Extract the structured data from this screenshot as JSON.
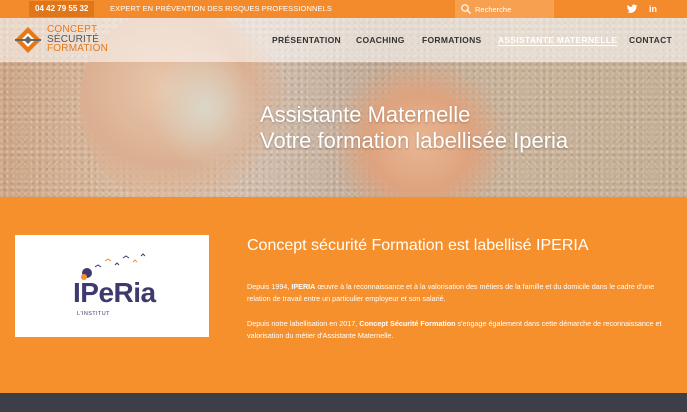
{
  "topbar": {
    "phone": "04 42 79 55 32",
    "tagline": "EXPERT EN PRÉVENTION DES RISQUES PROFESSIONNELS",
    "search_placeholder": "Recherche",
    "social": [
      "twitter-icon",
      "linkedin-icon"
    ],
    "linkedin_glyph": "in"
  },
  "logo": {
    "line1": "CONCEPT",
    "line2": "SÉCURITÉ",
    "line3": "FORMATION"
  },
  "nav": {
    "items": [
      {
        "label": "PRÉSENTATION"
      },
      {
        "label": "COACHING"
      },
      {
        "label": "FORMATIONS"
      },
      {
        "label": "ASSISTANTE MATERNELLE",
        "active": true
      },
      {
        "label": "CONTACT"
      }
    ]
  },
  "hero": {
    "line1": "Assistante Maternelle",
    "line2": "Votre formation labellisée Iperia"
  },
  "section": {
    "title": "Concept sécurité Formation est labellisé IPERIA",
    "p1_before": "Depuis 1994, ",
    "p1_bold": "IPERIA",
    "p1_after": " œuvre à la reconnaissance et à la valorisation des métiers de la famille et du domicile dans le cadre d'une relation de travail entre un particulier employeur et son salarié.",
    "p2_before": "Depuis notre labellisation en 2017, ",
    "p2_bold": "Concept Sécurité Formation",
    "p2_after": " s'engage également dans cette démarche de reconnaissance et valorisation du métier d'Assistante Maternelle."
  },
  "card": {
    "word": "IPeRia",
    "sub": "L'INSTITUT"
  },
  "colors": {
    "brand_orange": "#f6902d",
    "topbar_orange": "#f38b2c",
    "dark_footer": "#3c3f48",
    "iperia_purple": "#3e3a6e"
  }
}
